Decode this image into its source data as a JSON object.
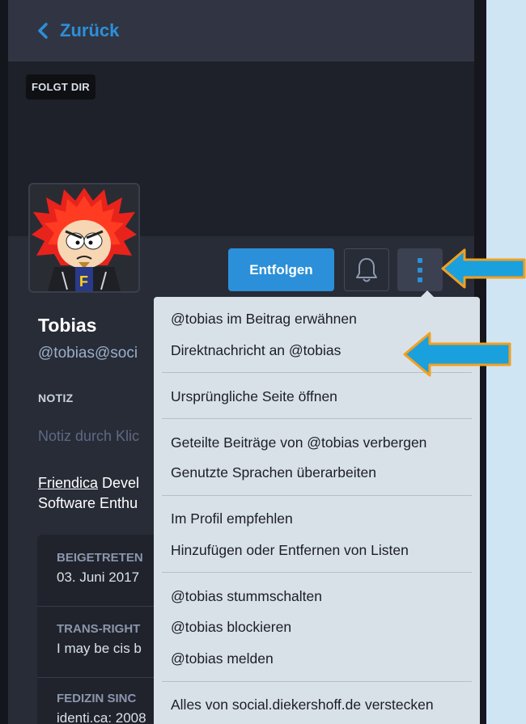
{
  "header": {
    "back_label": "Zurück"
  },
  "banner": {
    "follows_you_badge": "FOLGT DIR"
  },
  "profile": {
    "display_name": "Tobias",
    "handle": "@tobias@soci",
    "note_label": "NOTIZ",
    "note_placeholder": "Notiz durch Klic",
    "bio_link": "Friendica",
    "bio_line1_rest": " Devel",
    "bio_line2": "Software Enthu"
  },
  "actions": {
    "unfollow_label": "Entfolgen",
    "bell_icon": "bell-icon",
    "more_icon": "vertical-dots-icon"
  },
  "fields": [
    {
      "name": "BEIGETRETEN",
      "value": "03. Juni 2017"
    },
    {
      "name": "TRANS-RIGHT",
      "value": "I may be cis b"
    },
    {
      "name": "FEDIZIN SINC",
      "value": "identi.ca: 2008"
    }
  ],
  "menu": {
    "items": [
      "@tobias im Beitrag erwähnen",
      "Direktnachricht an @tobias",
      "Ursprüngliche Seite öffnen",
      "Geteilte Beiträge von @tobias verbergen",
      "Genutzte Sprachen überarbeiten",
      "Im Profil empfehlen",
      "Hinzufügen oder Entfernen von Listen",
      "@tobias stummschalten",
      "@tobias blockieren",
      "@tobias melden",
      "Alles von social.diekershoff.de verstecken"
    ]
  },
  "colors": {
    "accent": "#2b90d9",
    "menu_bg": "#d9e1e8",
    "arrow_fill": "#1aa0dd",
    "arrow_outline": "#f2a020"
  }
}
